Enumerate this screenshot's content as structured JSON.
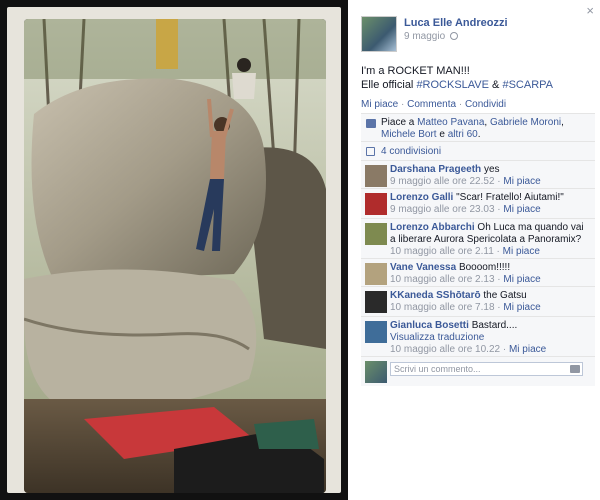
{
  "post": {
    "author": "Luca Elle Andreozzi",
    "date": "9 maggio",
    "text_line1": "I'm a ROCKET MAN!!!",
    "text_line2_prefix": "Elle official ",
    "hashtag1": "#ROCKSLAVE",
    "joiner": " & ",
    "hashtag2": "#SCARPA"
  },
  "actions": {
    "like": "Mi piace",
    "comment": "Commenta",
    "share": "Condividi",
    "separator": " · "
  },
  "likes": {
    "prefix": "Piace a ",
    "name1": "Matteo Pavana",
    "sep1": ", ",
    "name2": "Gabriele Moroni",
    "sep2": ", ",
    "name3": "Michele Bort",
    "conj": " e ",
    "others": "altri 60",
    "suffix": "."
  },
  "shares": {
    "label": "4 condivisioni"
  },
  "comments": [
    {
      "name": "Darshana Prageeth",
      "text": "yes",
      "time": "9 maggio alle ore 22.52",
      "like": "Mi piace",
      "avatar_color": "#8a7a66"
    },
    {
      "name": "Lorenzo Galli",
      "text": "\"Scar! Fratello! Aiutami!\"",
      "time": "9 maggio alle ore 23.03",
      "like": "Mi piace",
      "avatar_color": "#b02c2c"
    },
    {
      "name": "Lorenzo Abbarchi",
      "text": "Oh Luca ma quando vai a liberare Aurora Spericolata a Panoramix?",
      "time": "10 maggio alle ore 2.11",
      "like": "Mi piace",
      "avatar_color": "#7e8a50"
    },
    {
      "name": "Vane Vanessa",
      "text": "Boooom!!!!!",
      "time": "10 maggio alle ore 2.13",
      "like": "Mi piace",
      "avatar_color": "#b3a27e"
    },
    {
      "name": "KKaneda SShōtarō",
      "text": "the Gatsu",
      "time": "10 maggio alle ore 7.18",
      "like": "Mi piace",
      "avatar_color": "#2a2a2a"
    },
    {
      "name": "Gianluca Bosetti",
      "text": "Bastard....",
      "translate": "Visualizza traduzione",
      "time": "10 maggio alle ore 10.22",
      "like": "Mi piace",
      "avatar_color": "#3f6d99"
    }
  ],
  "composer": {
    "placeholder": "Scrivi un commento..."
  },
  "colors": {
    "link": "#3b5998",
    "meta": "#9197a3",
    "panel_bg": "#f6f7f9"
  }
}
